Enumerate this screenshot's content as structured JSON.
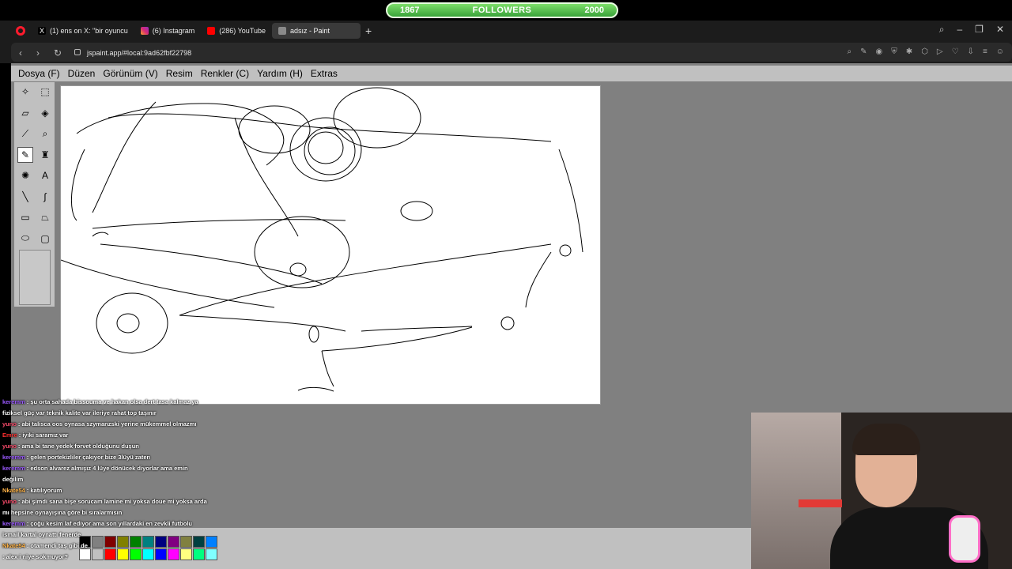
{
  "overlay": {
    "followers_current": "1867",
    "followers_label": "FOLLOWERS",
    "followers_goal": "2000"
  },
  "browser": {
    "tabs": [
      {
        "label": "(1) ens on X: \"bir oyuncu",
        "icon": "x-logo-icon"
      },
      {
        "label": "(6) Instagram",
        "icon": "instagram-icon"
      },
      {
        "label": "(286) YouTube",
        "icon": "youtube-icon"
      },
      {
        "label": "adsız - Paint",
        "icon": "paint-icon",
        "active": true
      }
    ],
    "url": "jspaint.app/#local:9ad62fbf22798"
  },
  "app": {
    "menu": [
      "Dosya (F)",
      "Düzen",
      "Görünüm (V)",
      "Resim",
      "Renkler (C)",
      "Yardım (H)",
      "Extras"
    ],
    "tools": [
      {
        "name": "free-form-select-tool",
        "glyph": "✧"
      },
      {
        "name": "rect-select-tool",
        "glyph": "⬚"
      },
      {
        "name": "eraser-tool",
        "glyph": "▱"
      },
      {
        "name": "fill-tool",
        "glyph": "◈"
      },
      {
        "name": "color-picker-tool",
        "glyph": "⟋"
      },
      {
        "name": "magnifier-tool",
        "glyph": "⌕"
      },
      {
        "name": "pencil-tool",
        "glyph": "✎",
        "selected": true
      },
      {
        "name": "brush-tool",
        "glyph": "♜"
      },
      {
        "name": "airbrush-tool",
        "glyph": "✺"
      },
      {
        "name": "text-tool",
        "glyph": "A"
      },
      {
        "name": "line-tool",
        "glyph": "╲"
      },
      {
        "name": "curve-tool",
        "glyph": "∫"
      },
      {
        "name": "rectangle-tool",
        "glyph": "▭"
      },
      {
        "name": "polygon-tool",
        "glyph": "⏢"
      },
      {
        "name": "ellipse-tool",
        "glyph": "⬭"
      },
      {
        "name": "rounded-rect-tool",
        "glyph": "▢"
      }
    ],
    "palette": [
      "#000000",
      "#808080",
      "#800000",
      "#808000",
      "#008000",
      "#008080",
      "#000080",
      "#800080",
      "#808040",
      "#004040",
      "#0080ff",
      "#ffffff",
      "#c0c0c0",
      "#ff0000",
      "#ffff00",
      "#00ff00",
      "#00ffff",
      "#0000ff",
      "#ff00ff",
      "#ffff80",
      "#00ff80",
      "#80ffff"
    ]
  },
  "chat": [
    {
      "user": "keremm",
      "text": ": şu orta sahada bissouma ve hakan olsa dert tasa kalmaz ya",
      "color": "#9b59ff"
    },
    {
      "user": "",
      "text": "fiziksel güç var teknik kalite var ileriye rahat top taşınır",
      "color": "#ffffff"
    },
    {
      "user": "yuno",
      "text": ": abi talisca oos oynasa szymanzski yerine mükemmel olmazmı",
      "color": "#ff4d6d"
    },
    {
      "user": "Emre",
      "text": ": iyiki saramız var",
      "color": "#ff3030"
    },
    {
      "user": "yuno",
      "text": ": ama bi tane yedek forvet olduğunu duşun",
      "color": "#ff4d6d"
    },
    {
      "user": "keremm",
      "text": ": gelen portekizliler çakıyor bize 3lüyü zaten",
      "color": "#9b59ff"
    },
    {
      "user": "keremm",
      "text": ": edson alvarez almışız 4 lüye dönücek diyorlar ama emin",
      "color": "#9b59ff"
    },
    {
      "user": "",
      "text": "değilim",
      "color": "#ffffff"
    },
    {
      "user": "Nkate54",
      "text": ": katılıyorum",
      "color": "#ffb347"
    },
    {
      "user": "yuno",
      "text": ": abi şimdi sana bişe sorucam lamine mi yoksa doue mi yoksa arda",
      "color": "#ff4d6d"
    },
    {
      "user": "",
      "text": "mı hepsine oynayışına göre bi sıralarmısın",
      "color": "#ffffff"
    },
    {
      "user": "keremm",
      "text": ": çoğu kesim laf ediyor ama son yıllardaki en zevkli futbolu",
      "color": "#9b59ff"
    },
    {
      "user": "",
      "text": "ismail kartal oynattı fenerde",
      "color": "#ffffff"
    },
    {
      "user": "Nkate54",
      "text": ": otamendi taş gibi de",
      "color": "#ffb347"
    },
    {
      "user": "",
      "text": ": alex i niye sokmuyor?",
      "color": "#ff3030"
    }
  ]
}
